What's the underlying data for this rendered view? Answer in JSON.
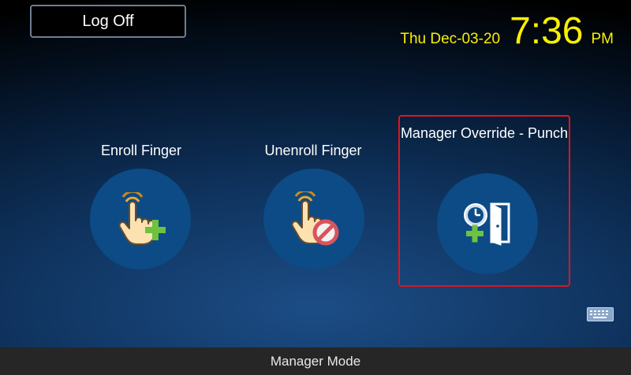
{
  "header": {
    "logoff_label": "Log Off",
    "date": "Thu Dec-03-20",
    "time": "7:36",
    "ampm": "PM"
  },
  "tiles": [
    {
      "label": "Enroll Finger",
      "icon": "hand-plus-icon"
    },
    {
      "label": "Unenroll Finger",
      "icon": "hand-no-icon"
    },
    {
      "label": "Manager Override - Punch",
      "icon": "clock-door-plus-icon",
      "selected": true
    }
  ],
  "keyboard_icon": "keyboard-icon",
  "status": {
    "mode": "Manager Mode"
  },
  "colors": {
    "clock": "#f8f000",
    "selection_border": "#e0141e",
    "tile_circle": "#0c4b86",
    "status_bar": "#262626"
  }
}
